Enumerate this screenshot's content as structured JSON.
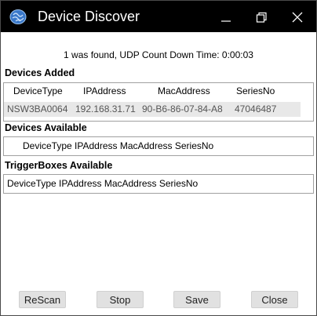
{
  "window": {
    "title": "Device Discover"
  },
  "status_text": "1 was found, UDP Count Down Time: 0:00:03",
  "devices_added": {
    "label": "Devices Added",
    "columns": [
      "DeviceType",
      "IPAddress",
      "MacAddress",
      "SeriesNo"
    ],
    "rows": [
      [
        "NSW3BA0064",
        "192.168.31.71",
        "90-B6-86-07-84-A8",
        "47046487"
      ]
    ]
  },
  "devices_available": {
    "label": "Devices Available",
    "header_text": "DeviceType IPAddress MacAddress SeriesNo"
  },
  "triggerboxes_available": {
    "label": "TriggerBoxes Available",
    "header_text": "DeviceType IPAddress MacAddress SeriesNo"
  },
  "buttons": {
    "rescan": "ReScan",
    "stop": "Stop",
    "save": "Save",
    "close": "Close"
  },
  "colors": {
    "titlebar": "#000000",
    "selected_row": "#e8e8e8",
    "button_face": "#e1e1e1"
  }
}
